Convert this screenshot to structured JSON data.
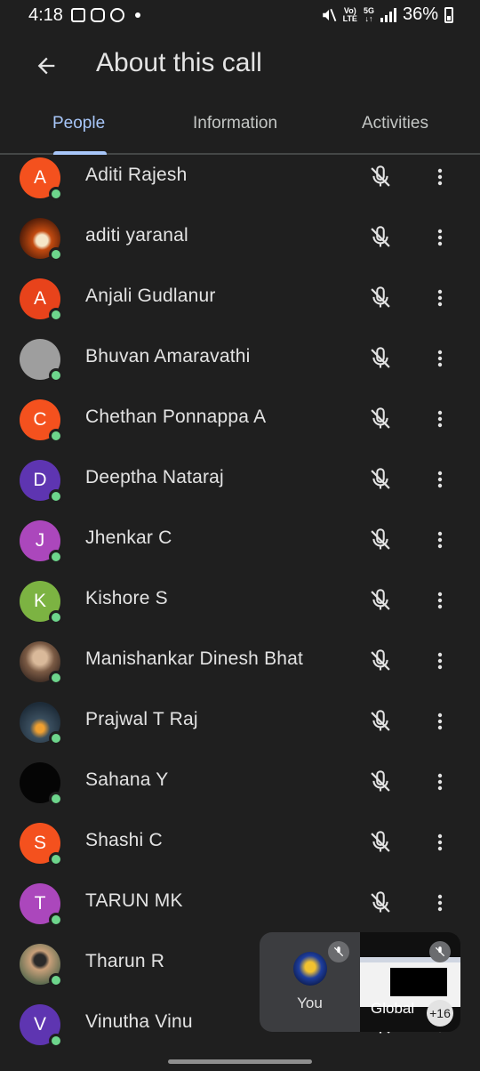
{
  "status_bar": {
    "time": "4:18",
    "network_top": "Vo)",
    "network_bottom": "LTE",
    "gen_top": "5G",
    "gen_bottom": "↓↑",
    "battery": "36%"
  },
  "header": {
    "title": "About this call"
  },
  "tabs": [
    {
      "label": "People",
      "active": true
    },
    {
      "label": "Information",
      "active": false
    },
    {
      "label": "Activities",
      "active": false
    }
  ],
  "participants": [
    {
      "name": "Aditi Rajesh",
      "initial": "A",
      "avatar_color": "#f4511e",
      "photo": ""
    },
    {
      "name": "aditi yaranal",
      "initial": "",
      "avatar_color": "",
      "photo": "devil"
    },
    {
      "name": "Anjali Gudlanur",
      "initial": "A",
      "avatar_color": "#e8431b",
      "photo": ""
    },
    {
      "name": "Bhuvan Amaravathi",
      "initial": "",
      "avatar_color": "",
      "photo": "gray"
    },
    {
      "name": "Chethan Ponnappa A",
      "initial": "C",
      "avatar_color": "#f4511e",
      "photo": ""
    },
    {
      "name": "Deeptha Nataraj",
      "initial": "D",
      "avatar_color": "#5e35b1",
      "photo": ""
    },
    {
      "name": "Jhenkar C",
      "initial": "J",
      "avatar_color": "#ab47bc",
      "photo": ""
    },
    {
      "name": "Kishore S",
      "initial": "K",
      "avatar_color": "#7cb342",
      "photo": ""
    },
    {
      "name": "Manishankar Dinesh Bhat",
      "initial": "",
      "avatar_color": "",
      "photo": "man"
    },
    {
      "name": "Prajwal T Raj",
      "initial": "",
      "avatar_color": "",
      "photo": "tent"
    },
    {
      "name": "Sahana Y",
      "initial": "",
      "avatar_color": "",
      "photo": "black"
    },
    {
      "name": "Shashi C",
      "initial": "S",
      "avatar_color": "#f4511e",
      "photo": ""
    },
    {
      "name": "TARUN MK",
      "initial": "T",
      "avatar_color": "#ab47bc",
      "photo": ""
    },
    {
      "name": "Tharun R",
      "initial": "",
      "avatar_color": "",
      "photo": "kid"
    },
    {
      "name": "Vinutha Vinu",
      "initial": "V",
      "avatar_color": "#5e35b1",
      "photo": ""
    }
  ],
  "pip": {
    "self_label": "You",
    "share_label": "Global",
    "more_count": "+16"
  },
  "colors": {
    "background": "#1f1f1f",
    "accent": "#a8c7fa",
    "presence": "#6dd58c"
  }
}
